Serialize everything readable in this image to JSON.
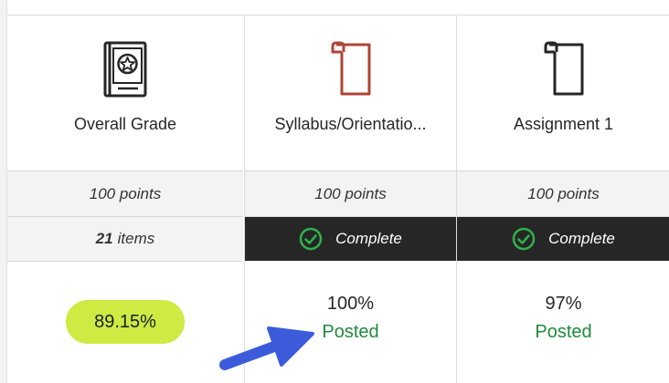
{
  "colors": {
    "accent_complete": "#1f8a3c",
    "grade_pill": "#cdeb43",
    "status_dark_bg": "#262626",
    "syllabus_icon": "#b0443a",
    "arrow": "#3b5bdb"
  },
  "columns": [
    {
      "title": "Overall Grade",
      "icon": "gradebook-star-icon",
      "points": "100 points",
      "items_count": "21",
      "items_label": "items",
      "grade": "89.15%"
    },
    {
      "title": "Syllabus/Orientatio...",
      "icon": "scroll-document-icon",
      "points": "100 points",
      "status": "Complete",
      "grade": "100%",
      "grade_status": "Posted"
    },
    {
      "title": "Assignment 1",
      "icon": "scroll-document-icon",
      "points": "100 points",
      "status": "Complete",
      "grade": "97%",
      "grade_status": "Posted"
    }
  ]
}
